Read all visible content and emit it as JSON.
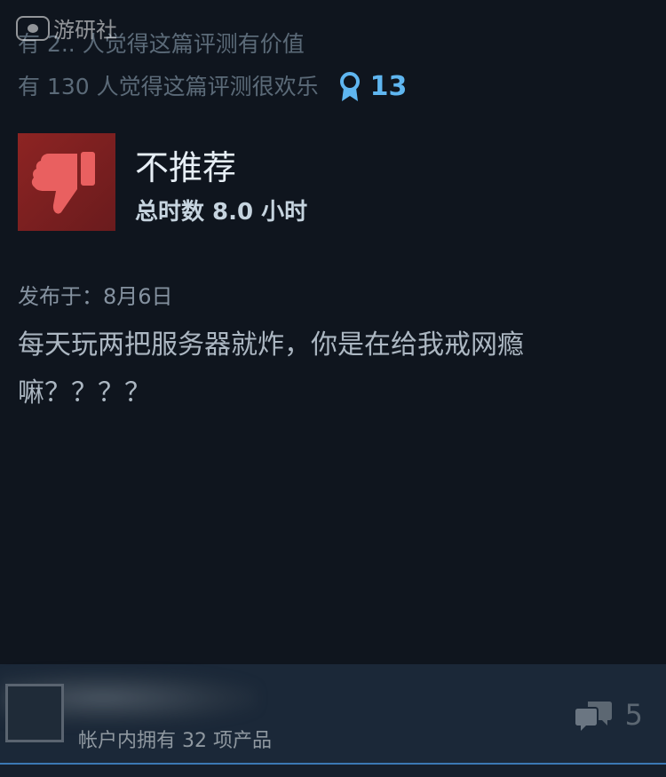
{
  "watermark": {
    "text": "游研社"
  },
  "helpful": {
    "line1": "有 2.. 人觉得这篇评测有价值",
    "line2": "有 130 人觉得这篇评测很欢乐",
    "award_count": "13"
  },
  "review": {
    "verdict": "不推荐",
    "hours": "总时数 8.0 小时",
    "posted": "发布于：8月6日",
    "body": "每天玩两把服务器就炸，你是在给我戒网瘾嘛？？？？"
  },
  "author": {
    "products": "帐户内拥有 32 项产品"
  },
  "comments": {
    "count": "5"
  },
  "colors": {
    "background": "#0f151e",
    "footer": "#1b2838",
    "thumb_down": "#e05a5a",
    "award": "#5fb6f0"
  },
  "icons": {
    "thumb": "thumbs-down-icon",
    "award": "award-ribbon-icon",
    "comment": "comment-bubbles-icon"
  }
}
